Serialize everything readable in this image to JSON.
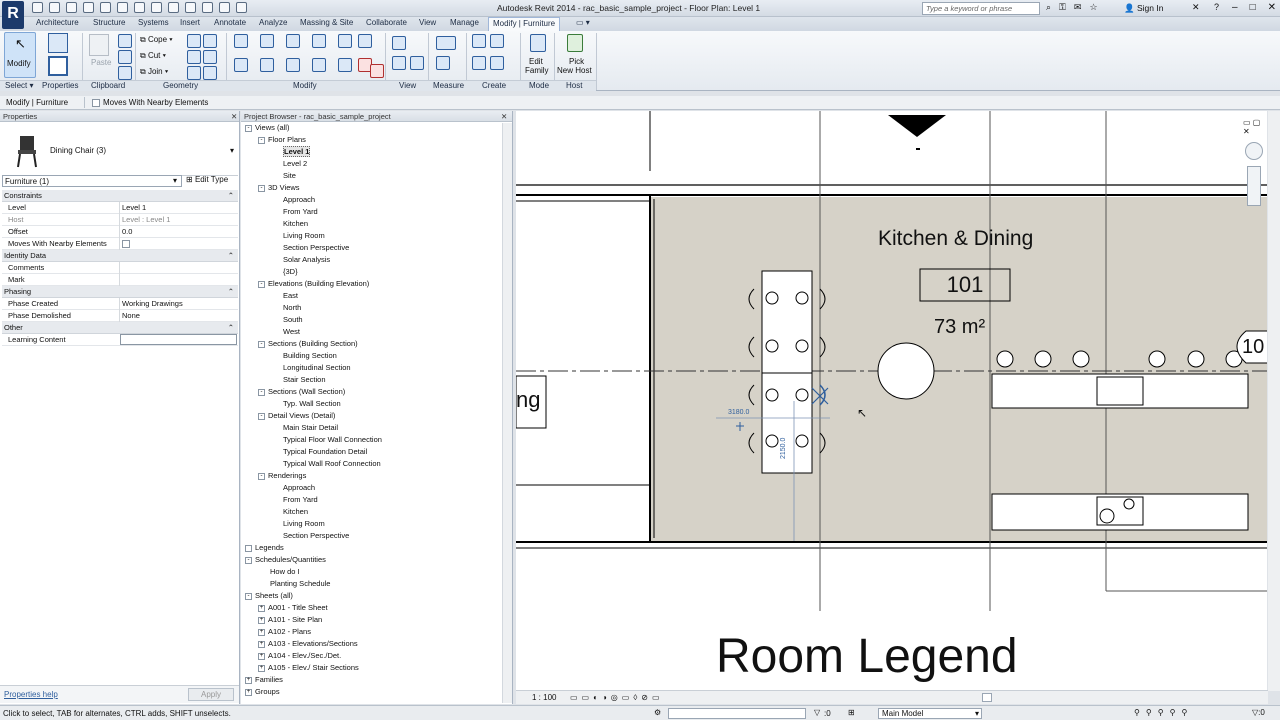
{
  "app": {
    "title": "Autodesk Revit 2014 -    rac_basic_sample_project - Floor Plan: Level 1",
    "logo": "R",
    "search_placeholder": "Type a keyword or phrase",
    "sign_in": "Sign In"
  },
  "ribbon_tabs": [
    "Architecture",
    "Structure",
    "Systems",
    "Insert",
    "Annotate",
    "Analyze",
    "Massing & Site",
    "Collaborate",
    "View",
    "Manage",
    "Modify | Furniture"
  ],
  "ribbon": {
    "modify_label": "Modify",
    "clipboard_paste": "Paste",
    "geometry": [
      "Cope",
      "Cut",
      "Join"
    ],
    "edit_family": [
      "Edit",
      "Family"
    ],
    "pick_new_host": [
      "Pick",
      "New Host"
    ],
    "panels": [
      "Select",
      "Properties",
      "Clipboard",
      "Geometry",
      "Modify",
      "View",
      "Measure",
      "Create",
      "Mode",
      "Host"
    ]
  },
  "options_bar": {
    "context": "Modify | Furniture",
    "moves_with_nearby": "Moves With Nearby Elements"
  },
  "properties": {
    "header": "Properties",
    "type_name": "Dining Chair (3)",
    "selector": "Furniture (1)",
    "edit_type": "Edit Type",
    "rows": [
      {
        "cat": "Constraints"
      },
      {
        "k": "Level",
        "v": "Level 1"
      },
      {
        "k": "Host",
        "v": "Level : Level 1"
      },
      {
        "k": "Offset",
        "v": "0.0"
      },
      {
        "k": "Moves With Nearby Elements",
        "v": ""
      },
      {
        "cat": "Identity Data"
      },
      {
        "k": "Comments",
        "v": ""
      },
      {
        "k": "Mark",
        "v": ""
      },
      {
        "cat": "Phasing"
      },
      {
        "k": "Phase Created",
        "v": "Working Drawings"
      },
      {
        "k": "Phase Demolished",
        "v": "None"
      },
      {
        "cat": "Other"
      },
      {
        "k": "Learning Content",
        "v": ""
      }
    ],
    "help": "Properties help",
    "apply": "Apply"
  },
  "project_browser": {
    "header": "Project Browser - rac_basic_sample_project",
    "tree": [
      {
        "t": "Views (all)",
        "d": 0,
        "e": "-"
      },
      {
        "t": "Floor Plans",
        "d": 1,
        "e": "-"
      },
      {
        "t": "Level 1",
        "d": 2,
        "sel": true
      },
      {
        "t": "Level 2",
        "d": 2
      },
      {
        "t": "Site",
        "d": 2
      },
      {
        "t": "3D Views",
        "d": 1,
        "e": "-"
      },
      {
        "t": "Approach",
        "d": 2
      },
      {
        "t": "From Yard",
        "d": 2
      },
      {
        "t": "Kitchen",
        "d": 2
      },
      {
        "t": "Living Room",
        "d": 2
      },
      {
        "t": "Section Perspective",
        "d": 2
      },
      {
        "t": "Solar Analysis",
        "d": 2
      },
      {
        "t": "{3D}",
        "d": 2
      },
      {
        "t": "Elevations (Building Elevation)",
        "d": 1,
        "e": "-"
      },
      {
        "t": "East",
        "d": 2
      },
      {
        "t": "North",
        "d": 2
      },
      {
        "t": "South",
        "d": 2
      },
      {
        "t": "West",
        "d": 2
      },
      {
        "t": "Sections (Building Section)",
        "d": 1,
        "e": "-"
      },
      {
        "t": "Building Section",
        "d": 2
      },
      {
        "t": "Longitudinal Section",
        "d": 2
      },
      {
        "t": "Stair Section",
        "d": 2
      },
      {
        "t": "Sections (Wall Section)",
        "d": 1,
        "e": "-"
      },
      {
        "t": "Typ. Wall Section",
        "d": 2
      },
      {
        "t": "Detail Views (Detail)",
        "d": 1,
        "e": "-"
      },
      {
        "t": "Main Stair Detail",
        "d": 2
      },
      {
        "t": "Typical Floor Wall Connection",
        "d": 2
      },
      {
        "t": "Typical Foundation Detail",
        "d": 2
      },
      {
        "t": "Typical Wall Roof Connection",
        "d": 2
      },
      {
        "t": "Renderings",
        "d": 1,
        "e": "-"
      },
      {
        "t": "Approach",
        "d": 2
      },
      {
        "t": "From Yard",
        "d": 2
      },
      {
        "t": "Kitchen",
        "d": 2
      },
      {
        "t": "Living Room",
        "d": 2
      },
      {
        "t": "Section Perspective",
        "d": 2
      },
      {
        "t": "Legends",
        "d": 0,
        "e": " "
      },
      {
        "t": "Schedules/Quantities",
        "d": 0,
        "e": "-"
      },
      {
        "t": "How do I",
        "d": 1
      },
      {
        "t": "Planting Schedule",
        "d": 1
      },
      {
        "t": "Sheets (all)",
        "d": 0,
        "e": "-"
      },
      {
        "t": "A001 - Title Sheet",
        "d": 1,
        "e": "+"
      },
      {
        "t": "A101 - Site Plan",
        "d": 1,
        "e": "+"
      },
      {
        "t": "A102 - Plans",
        "d": 1,
        "e": "+"
      },
      {
        "t": "A103 - Elevations/Sections",
        "d": 1,
        "e": "+"
      },
      {
        "t": "A104 - Elev./Sec./Det.",
        "d": 1,
        "e": "+"
      },
      {
        "t": "A105 - Elev./ Stair Sections",
        "d": 1,
        "e": "+"
      },
      {
        "t": "Families",
        "d": 0,
        "e": "+"
      },
      {
        "t": "Groups",
        "d": 0,
        "e": "+"
      }
    ]
  },
  "drawing": {
    "room_name": "Kitchen & Dining",
    "room_number": "101",
    "room_area": "73 m²",
    "left_tag": "ng",
    "right_tag": "10",
    "legend_title": "Room Legend",
    "dim_h": "3180.0",
    "dim_v": "2150.0",
    "scale": "1 : 100"
  },
  "status": {
    "hint": "Click to select, TAB for alternates, CTRL adds, SHIFT unselects.",
    "coord": ":0",
    "model": "Main Model"
  },
  "colors": {
    "room_fill": "#d6d2c8",
    "accent": "#2f5f9e",
    "active_tab": "#f8fafc"
  }
}
